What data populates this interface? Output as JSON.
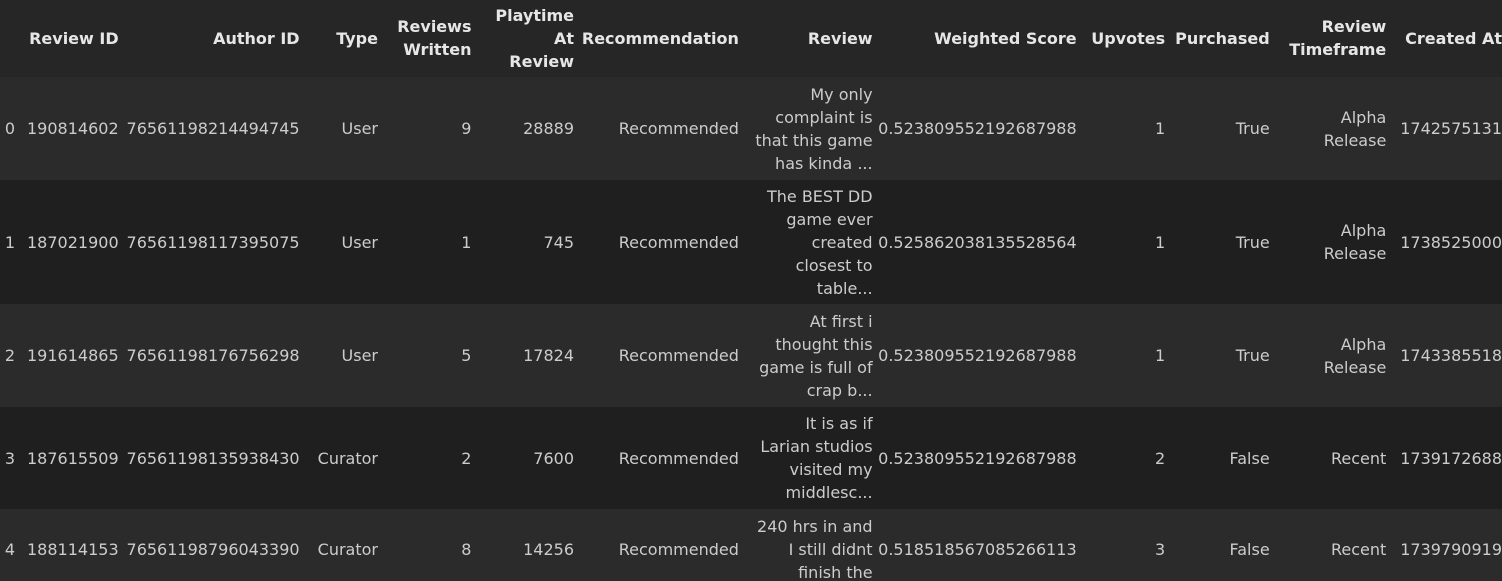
{
  "columns": [
    "",
    "Review ID",
    "Author ID",
    "Type",
    "Reviews Written",
    "Playtime At Review",
    "Recommendation",
    "Review",
    "Weighted Score",
    "Upvotes",
    "Purchased",
    "Review Timeframe",
    "Created At"
  ],
  "column_headers_display": {
    "reviews_written": [
      "Reviews",
      "Written"
    ],
    "playtime_at_review": [
      "Playtime",
      "At",
      "Review"
    ],
    "review_timeframe": [
      "Review",
      "Timeframe"
    ]
  },
  "rows": [
    {
      "index": "0",
      "review_id": "190814602",
      "author_id": "76561198214494745",
      "type": "User",
      "reviews_written": "9",
      "playtime_at_review": "28889",
      "recommendation": "Recommended",
      "review_lines": [
        "My only",
        "complaint is",
        "that this game",
        "has kinda ..."
      ],
      "weighted_score": "0.523809552192687988",
      "upvotes": "1",
      "purchased": "True",
      "timeframe_lines": [
        "Alpha",
        "Release"
      ],
      "created_at": "1742575131"
    },
    {
      "index": "1",
      "review_id": "187021900",
      "author_id": "76561198117395075",
      "type": "User",
      "reviews_written": "1",
      "playtime_at_review": "745",
      "recommendation": "Recommended",
      "review_lines": [
        "The BEST DD",
        "game ever",
        "created",
        "closest to",
        "table..."
      ],
      "weighted_score": "0.525862038135528564",
      "upvotes": "1",
      "purchased": "True",
      "timeframe_lines": [
        "Alpha",
        "Release"
      ],
      "created_at": "1738525000"
    },
    {
      "index": "2",
      "review_id": "191614865",
      "author_id": "76561198176756298",
      "type": "User",
      "reviews_written": "5",
      "playtime_at_review": "17824",
      "recommendation": "Recommended",
      "review_lines": [
        "At first i",
        "thought this",
        "game is full of",
        "crap b..."
      ],
      "weighted_score": "0.523809552192687988",
      "upvotes": "1",
      "purchased": "True",
      "timeframe_lines": [
        "Alpha",
        "Release"
      ],
      "created_at": "1743385518"
    },
    {
      "index": "3",
      "review_id": "187615509",
      "author_id": "76561198135938430",
      "type": "Curator",
      "reviews_written": "2",
      "playtime_at_review": "7600",
      "recommendation": "Recommended",
      "review_lines": [
        "It is as if",
        "Larian studios",
        "visited my",
        "middlesc..."
      ],
      "weighted_score": "0.523809552192687988",
      "upvotes": "2",
      "purchased": "False",
      "timeframe_lines": [
        "Recent"
      ],
      "created_at": "1739172688"
    },
    {
      "index": "4",
      "review_id": "188114153",
      "author_id": "76561198796043390",
      "type": "Curator",
      "reviews_written": "8",
      "playtime_at_review": "14256",
      "recommendation": "Recommended",
      "review_lines": [
        "240 hrs in and",
        "I still didnt",
        "finish the"
      ],
      "weighted_score": "0.518518567085266113",
      "upvotes": "3",
      "purchased": "False",
      "timeframe_lines": [
        "Recent"
      ],
      "created_at": "1739790919"
    }
  ]
}
